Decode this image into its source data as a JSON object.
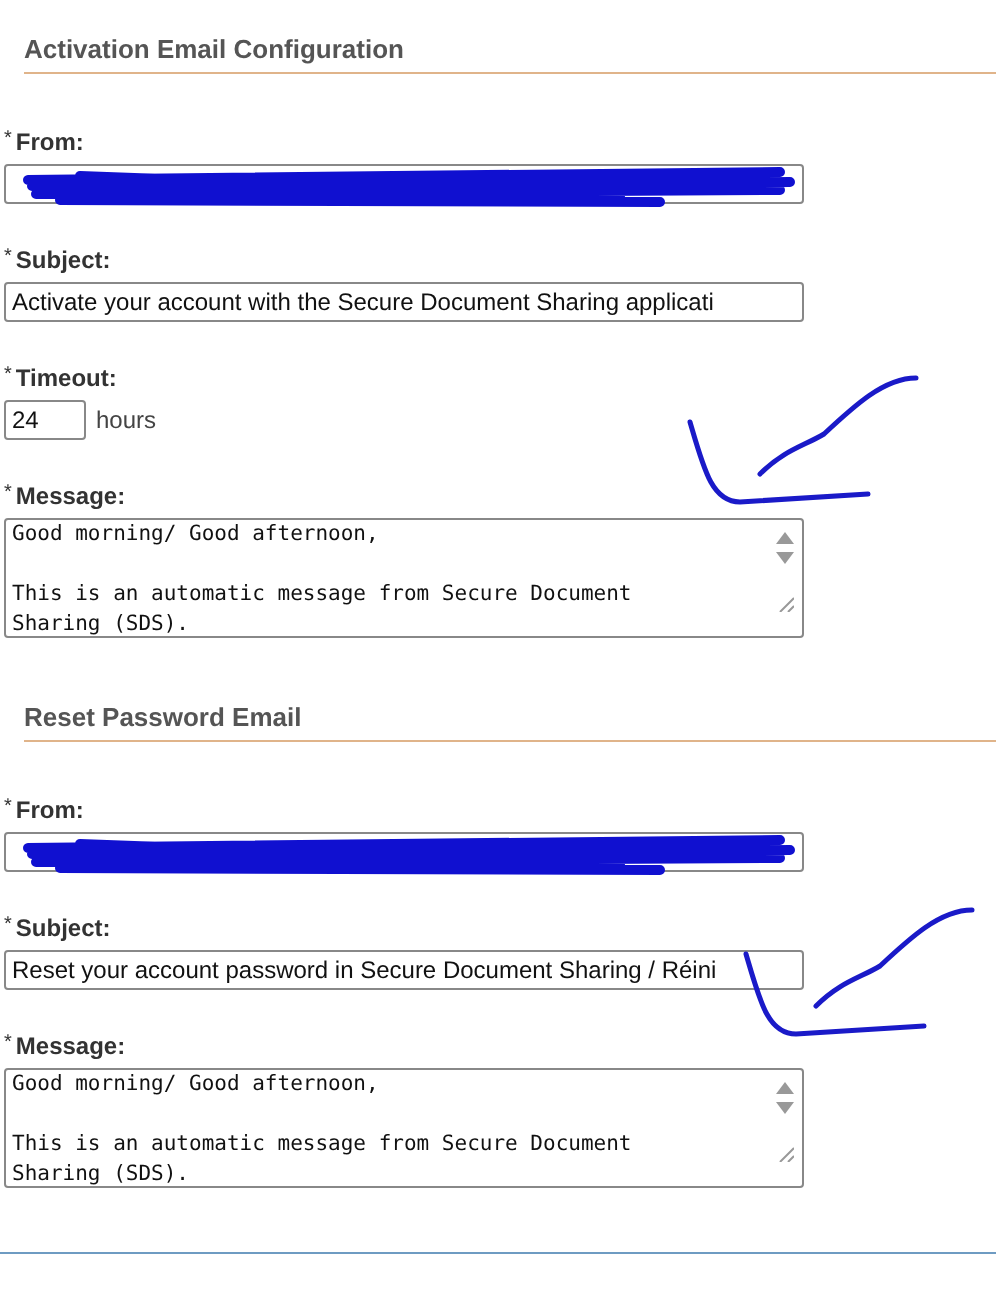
{
  "sections": [
    {
      "title": "Activation Email Configuration",
      "fields": [
        {
          "kind": "text",
          "marker": "*",
          "label": "From:",
          "redacted": true
        },
        {
          "kind": "text",
          "marker": "*",
          "label": "Subject:",
          "value": "Activate your account with the Secure Document Sharing applicati"
        },
        {
          "kind": "number",
          "marker": "*",
          "label": "Timeout:",
          "value": "24",
          "unit": "hours"
        },
        {
          "kind": "textarea",
          "marker": "*",
          "label": "Message:",
          "value": "Good morning/ Good afternoon,\n\nThis is an automatic message from Secure Document\nSharing (SDS)."
        }
      ]
    },
    {
      "title": "Reset Password Email",
      "fields": [
        {
          "kind": "text",
          "marker": "*",
          "label": "From:",
          "redacted": true
        },
        {
          "kind": "text",
          "marker": "*",
          "label": "Subject:",
          "value": "Reset your account password in Secure Document Sharing / Réini"
        },
        {
          "kind": "textarea",
          "marker": "*",
          "label": "Message:",
          "value": "Good morning/ Good afternoon,\n\nThis is an automatic message from Secure Document\nSharing (SDS)."
        }
      ]
    }
  ]
}
